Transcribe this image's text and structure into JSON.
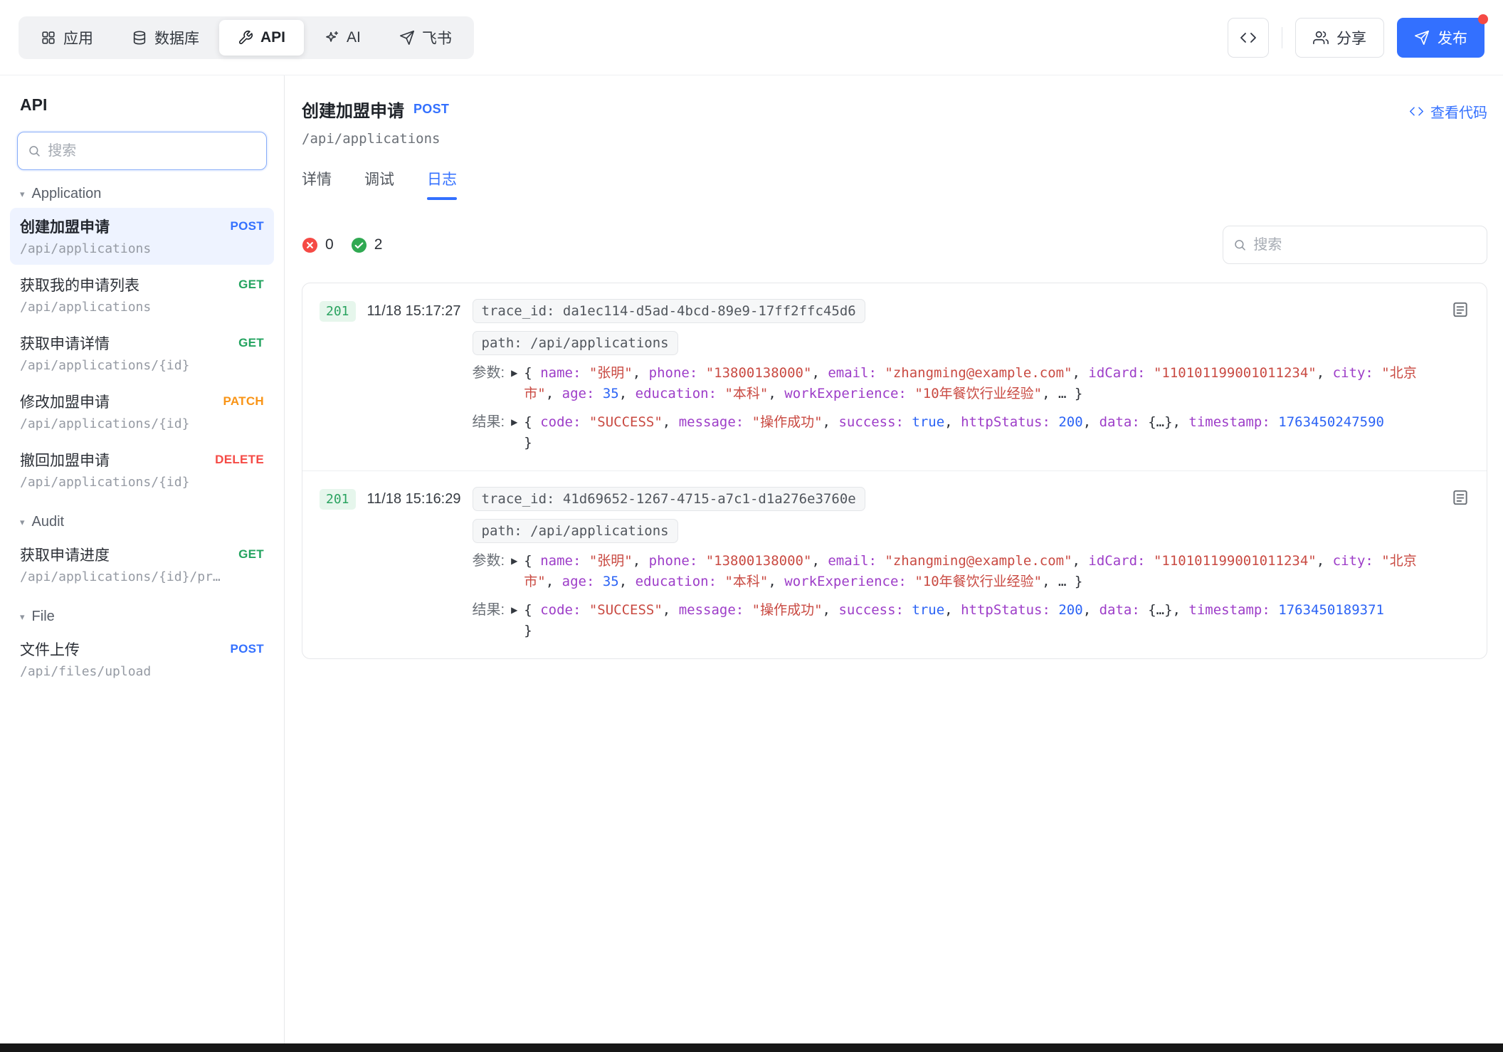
{
  "colors": {
    "accent": "#3370ff",
    "method-post": "#3370ff",
    "method-get": "#23a35f",
    "method-patch": "#f99416",
    "method-delete": "#f54a45",
    "status-error": "#f54a45",
    "status-success": "#30a952",
    "token-key": "#9d3dc8",
    "token-string": "#c94a42",
    "token-number": "#2b63f5"
  },
  "topbar": {
    "tabs": [
      {
        "id": "apps",
        "icon": "grid-icon",
        "label": "应用"
      },
      {
        "id": "database",
        "icon": "database-icon",
        "label": "数据库"
      },
      {
        "id": "api",
        "icon": "tool-icon",
        "label": "API",
        "active": true
      },
      {
        "id": "ai",
        "icon": "sparkle-icon",
        "label": "AI"
      },
      {
        "id": "feishu",
        "icon": "send-icon",
        "label": "飞书"
      }
    ],
    "share_label": "分享",
    "publish_label": "发布"
  },
  "sidebar": {
    "title": "API",
    "search_placeholder": "搜索",
    "groups": [
      {
        "id": "application",
        "label": "Application",
        "items": [
          {
            "title": "创建加盟申请",
            "method": "POST",
            "path": "/api/applications",
            "selected": true
          },
          {
            "title": "获取我的申请列表",
            "method": "GET",
            "path": "/api/applications"
          },
          {
            "title": "获取申请详情",
            "method": "GET",
            "path": "/api/applications/{id}"
          },
          {
            "title": "修改加盟申请",
            "method": "PATCH",
            "path": "/api/applications/{id}"
          },
          {
            "title": "撤回加盟申请",
            "method": "DELETE",
            "path": "/api/applications/{id}"
          }
        ]
      },
      {
        "id": "audit",
        "label": "Audit",
        "items": [
          {
            "title": "获取申请进度",
            "method": "GET",
            "path": "/api/applications/{id}/pr…"
          }
        ]
      },
      {
        "id": "file",
        "label": "File",
        "items": [
          {
            "title": "文件上传",
            "method": "POST",
            "path": "/api/files/upload"
          }
        ]
      }
    ]
  },
  "main": {
    "title": "创建加盟申请",
    "method": "POST",
    "path": "/api/applications",
    "view_code_label": "查看代码",
    "tabs": [
      {
        "label": "详情"
      },
      {
        "label": "调试"
      },
      {
        "label": "日志",
        "active": true
      }
    ],
    "stats": {
      "error_count": "0",
      "success_count": "2"
    },
    "search_placeholder": "搜索",
    "logs": [
      {
        "status": "201",
        "time": "11/18 15:17:27",
        "chips": [
          "trace_id: da1ec114-d5ad-4bcd-89e9-17ff2ffc45d6",
          "path: /api/applications"
        ],
        "rows": [
          {
            "label": "参数:",
            "tokens": [
              [
                "p",
                "{ "
              ],
              [
                "k",
                "name:"
              ],
              [
                "p",
                " "
              ],
              [
                "s",
                "\"张明\""
              ],
              [
                "p",
                ", "
              ],
              [
                "k",
                "phone:"
              ],
              [
                "p",
                " "
              ],
              [
                "s",
                "\"13800138000\""
              ],
              [
                "p",
                ", "
              ],
              [
                "k",
                "email:"
              ],
              [
                "p",
                " "
              ],
              [
                "s",
                "\"zhangming@example.com\""
              ],
              [
                "p",
                ", "
              ],
              [
                "k",
                "idCard:"
              ],
              [
                "p",
                " "
              ],
              [
                "s",
                "\"110101199001011234\""
              ],
              [
                "p",
                ", "
              ],
              [
                "k",
                "city:"
              ],
              [
                "p",
                " "
              ],
              [
                "s",
                "\"北京市\""
              ],
              [
                "p",
                ", "
              ],
              [
                "k",
                "age:"
              ],
              [
                "p",
                " "
              ],
              [
                "n",
                "35"
              ],
              [
                "p",
                ", "
              ],
              [
                "k",
                "education:"
              ],
              [
                "p",
                " "
              ],
              [
                "s",
                "\"本科\""
              ],
              [
                "p",
                ", "
              ],
              [
                "k",
                "workExperience:"
              ],
              [
                "p",
                " "
              ],
              [
                "s",
                "\"10年餐饮行业经验\""
              ],
              [
                "p",
                ", … }"
              ]
            ]
          },
          {
            "label": "结果:",
            "tokens": [
              [
                "p",
                "{ "
              ],
              [
                "k",
                "code:"
              ],
              [
                "p",
                " "
              ],
              [
                "s",
                "\"SUCCESS\""
              ],
              [
                "p",
                ", "
              ],
              [
                "k",
                "message:"
              ],
              [
                "p",
                " "
              ],
              [
                "s",
                "\"操作成功\""
              ],
              [
                "p",
                ", "
              ],
              [
                "k",
                "success:"
              ],
              [
                "p",
                " "
              ],
              [
                "n",
                "true"
              ],
              [
                "p",
                ", "
              ],
              [
                "k",
                "httpStatus:"
              ],
              [
                "p",
                " "
              ],
              [
                "n",
                "200"
              ],
              [
                "p",
                ", "
              ],
              [
                "k",
                "data:"
              ],
              [
                "p",
                " {…}, "
              ],
              [
                "k",
                "timestamp:"
              ],
              [
                "p",
                " "
              ],
              [
                "n",
                "1763450247590"
              ],
              [
                "p",
                "\n}"
              ]
            ]
          }
        ]
      },
      {
        "status": "201",
        "time": "11/18 15:16:29",
        "chips": [
          "trace_id: 41d69652-1267-4715-a7c1-d1a276e3760e",
          "path: /api/applications"
        ],
        "rows": [
          {
            "label": "参数:",
            "tokens": [
              [
                "p",
                "{ "
              ],
              [
                "k",
                "name:"
              ],
              [
                "p",
                " "
              ],
              [
                "s",
                "\"张明\""
              ],
              [
                "p",
                ", "
              ],
              [
                "k",
                "phone:"
              ],
              [
                "p",
                " "
              ],
              [
                "s",
                "\"13800138000\""
              ],
              [
                "p",
                ", "
              ],
              [
                "k",
                "email:"
              ],
              [
                "p",
                " "
              ],
              [
                "s",
                "\"zhangming@example.com\""
              ],
              [
                "p",
                ", "
              ],
              [
                "k",
                "idCard:"
              ],
              [
                "p",
                " "
              ],
              [
                "s",
                "\"110101199001011234\""
              ],
              [
                "p",
                ", "
              ],
              [
                "k",
                "city:"
              ],
              [
                "p",
                " "
              ],
              [
                "s",
                "\"北京市\""
              ],
              [
                "p",
                ", "
              ],
              [
                "k",
                "age:"
              ],
              [
                "p",
                " "
              ],
              [
                "n",
                "35"
              ],
              [
                "p",
                ", "
              ],
              [
                "k",
                "education:"
              ],
              [
                "p",
                " "
              ],
              [
                "s",
                "\"本科\""
              ],
              [
                "p",
                ", "
              ],
              [
                "k",
                "workExperience:"
              ],
              [
                "p",
                " "
              ],
              [
                "s",
                "\"10年餐饮行业经验\""
              ],
              [
                "p",
                ", … }"
              ]
            ]
          },
          {
            "label": "结果:",
            "tokens": [
              [
                "p",
                "{ "
              ],
              [
                "k",
                "code:"
              ],
              [
                "p",
                " "
              ],
              [
                "s",
                "\"SUCCESS\""
              ],
              [
                "p",
                ", "
              ],
              [
                "k",
                "message:"
              ],
              [
                "p",
                " "
              ],
              [
                "s",
                "\"操作成功\""
              ],
              [
                "p",
                ", "
              ],
              [
                "k",
                "success:"
              ],
              [
                "p",
                " "
              ],
              [
                "n",
                "true"
              ],
              [
                "p",
                ", "
              ],
              [
                "k",
                "httpStatus:"
              ],
              [
                "p",
                " "
              ],
              [
                "n",
                "200"
              ],
              [
                "p",
                ", "
              ],
              [
                "k",
                "data:"
              ],
              [
                "p",
                " {…}, "
              ],
              [
                "k",
                "timestamp:"
              ],
              [
                "p",
                " "
              ],
              [
                "n",
                "1763450189371"
              ],
              [
                "p",
                "\n}"
              ]
            ]
          }
        ]
      }
    ]
  }
}
